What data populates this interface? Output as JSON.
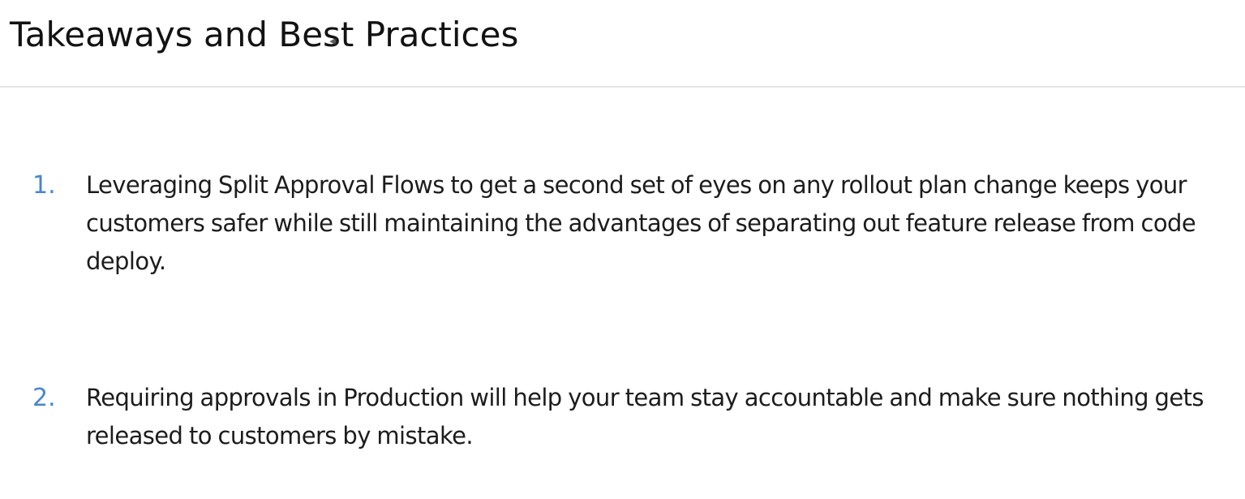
{
  "slide": {
    "title": "Takeaways and Best Practices"
  },
  "takeaways": [
    {
      "number": "1.",
      "text": "Leveraging Split Approval Flows to get a second set of eyes on any rollout plan change keeps your customers safer while still maintaining the advantages of separating out feature release from code deploy."
    },
    {
      "number": "2.",
      "text": "Requiring approvals in Production will help your team stay accountable and make sure nothing gets released to customers by mistake."
    }
  ],
  "colors": {
    "number_accent": "#4a86c8",
    "text": "#1c1c1c",
    "divider": "#e6e6e6"
  }
}
